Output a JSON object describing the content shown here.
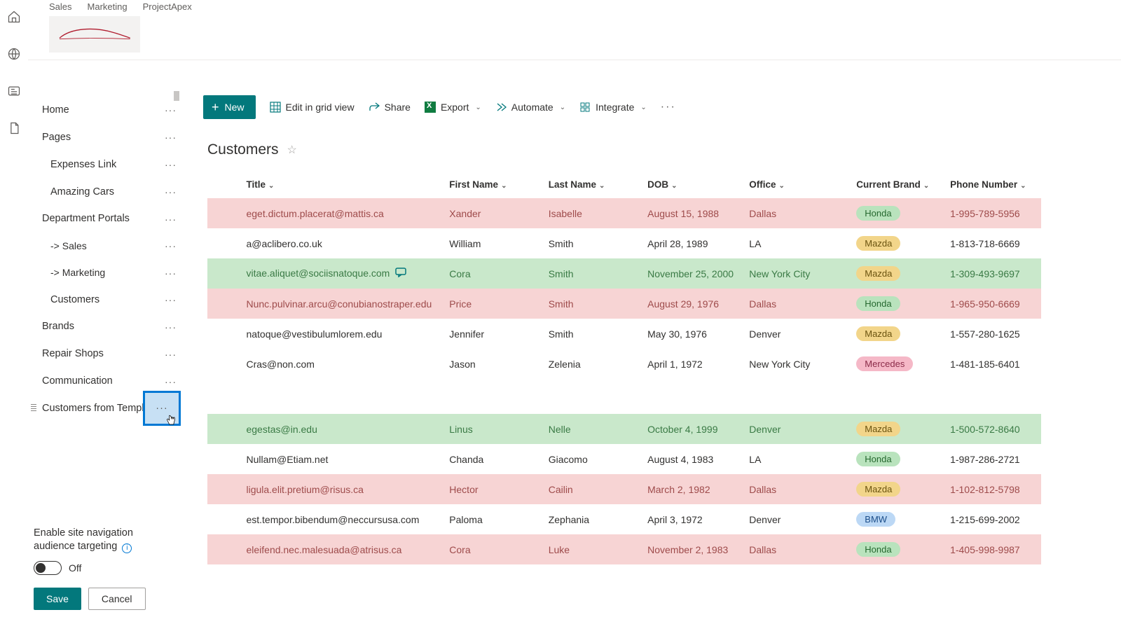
{
  "header": {
    "hub_tabs": [
      "Sales",
      "Marketing",
      "ProjectApex"
    ]
  },
  "nav": {
    "items": [
      {
        "label": "Home",
        "level": 0
      },
      {
        "label": "Pages",
        "level": 0
      },
      {
        "label": "Expenses Link",
        "level": 1
      },
      {
        "label": "Amazing Cars",
        "level": 1
      },
      {
        "label": "Department Portals",
        "level": 0
      },
      {
        "label": "-> Sales",
        "level": 2
      },
      {
        "label": "-> Marketing",
        "level": 2
      },
      {
        "label": "Customers",
        "level": 1
      },
      {
        "label": "Brands",
        "level": 0
      },
      {
        "label": "Repair Shops",
        "level": 0
      },
      {
        "label": "Communication",
        "level": 0
      },
      {
        "label": "Customers from Template",
        "level": 0,
        "dragging": true,
        "focused_dots": true
      }
    ],
    "audience": {
      "label": "Enable site navigation audience targeting",
      "toggle_state": "Off",
      "save": "Save",
      "cancel": "Cancel"
    }
  },
  "toolbar": {
    "new": "New",
    "edit_grid": "Edit in grid view",
    "share": "Share",
    "export": "Export",
    "automate": "Automate",
    "integrate": "Integrate"
  },
  "list": {
    "title": "Customers",
    "columns": [
      "Title",
      "First Name",
      "Last Name",
      "DOB",
      "Office",
      "Current Brand",
      "Phone Number"
    ],
    "rows": [
      {
        "title": "eget.dictum.placerat@mattis.ca",
        "first": "Xander",
        "last": "Isabelle",
        "dob": "August 15, 1988",
        "office": "Dallas",
        "brand": "Honda",
        "phone": "1-995-789-5956",
        "style": "pink"
      },
      {
        "title": "a@aclibero.co.uk",
        "first": "William",
        "last": "Smith",
        "dob": "April 28, 1989",
        "office": "LA",
        "brand": "Mazda",
        "phone": "1-813-718-6669",
        "style": "plain"
      },
      {
        "title": "vitae.aliquet@sociisnatoque.com",
        "first": "Cora",
        "last": "Smith",
        "dob": "November 25, 2000",
        "office": "New York City",
        "brand": "Mazda",
        "phone": "1-309-493-9697",
        "style": "green",
        "comment": true
      },
      {
        "title": "Nunc.pulvinar.arcu@conubianostraper.edu",
        "first": "Price",
        "last": "Smith",
        "dob": "August 29, 1976",
        "office": "Dallas",
        "brand": "Honda",
        "phone": "1-965-950-6669",
        "style": "pink"
      },
      {
        "title": "natoque@vestibulumlorem.edu",
        "first": "Jennifer",
        "last": "Smith",
        "dob": "May 30, 1976",
        "office": "Denver",
        "brand": "Mazda",
        "phone": "1-557-280-1625",
        "style": "plain"
      },
      {
        "title": "Cras@non.com",
        "first": "Jason",
        "last": "Zelenia",
        "dob": "April 1, 1972",
        "office": "New York City",
        "brand": "Mercedes",
        "phone": "1-481-185-6401",
        "style": "plain"
      },
      {
        "spacer": true
      },
      {
        "title": "egestas@in.edu",
        "first": "Linus",
        "last": "Nelle",
        "dob": "October 4, 1999",
        "office": "Denver",
        "brand": "Mazda",
        "phone": "1-500-572-8640",
        "style": "green"
      },
      {
        "title": "Nullam@Etiam.net",
        "first": "Chanda",
        "last": "Giacomo",
        "dob": "August 4, 1983",
        "office": "LA",
        "brand": "Honda",
        "phone": "1-987-286-2721",
        "style": "plain"
      },
      {
        "title": "ligula.elit.pretium@risus.ca",
        "first": "Hector",
        "last": "Cailin",
        "dob": "March 2, 1982",
        "office": "Dallas",
        "brand": "Mazda",
        "phone": "1-102-812-5798",
        "style": "pink"
      },
      {
        "title": "est.tempor.bibendum@neccursusa.com",
        "first": "Paloma",
        "last": "Zephania",
        "dob": "April 3, 1972",
        "office": "Denver",
        "brand": "BMW",
        "phone": "1-215-699-2002",
        "style": "plain"
      },
      {
        "title": "eleifend.nec.malesuada@atrisus.ca",
        "first": "Cora",
        "last": "Luke",
        "dob": "November 2, 1983",
        "office": "Dallas",
        "brand": "Honda",
        "phone": "1-405-998-9987",
        "style": "pink"
      }
    ]
  },
  "brand_class": {
    "Honda": "brand-honda",
    "Mazda": "brand-mazda",
    "Mercedes": "brand-mercedes",
    "BMW": "brand-bmw"
  }
}
